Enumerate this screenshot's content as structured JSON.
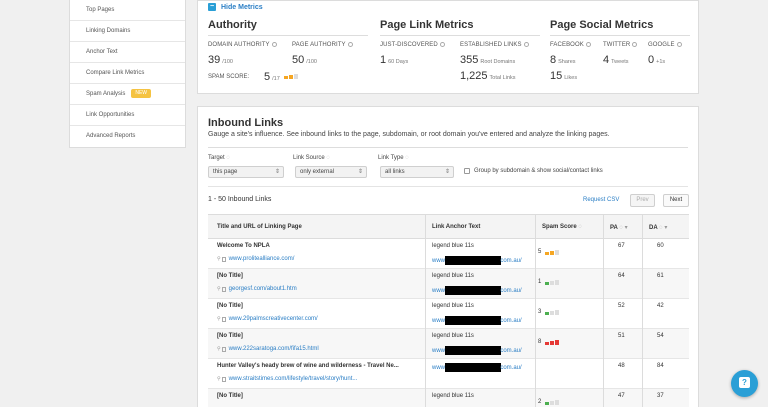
{
  "sidebar": {
    "items": [
      {
        "label": "Top Pages"
      },
      {
        "label": "Linking Domains"
      },
      {
        "label": "Anchor Text"
      },
      {
        "label": "Compare Link Metrics"
      },
      {
        "label": "Spam Analysis",
        "badge": "NEW"
      },
      {
        "label": "Link Opportunities"
      },
      {
        "label": "Advanced Reports"
      }
    ]
  },
  "metrics": {
    "hide_label": "Hide Metrics",
    "authority": {
      "title": "Authority",
      "domain_authority_label": "DOMAIN AUTHORITY",
      "domain_authority": "39",
      "domain_authority_max": "/100",
      "page_authority_label": "PAGE AUTHORITY",
      "page_authority": "50",
      "page_authority_max": "/100",
      "spam_label": "SPAM SCORE:",
      "spam_value": "5",
      "spam_max": "/17",
      "spam_level": 0.29
    },
    "page_link": {
      "title": "Page Link Metrics",
      "just_discovered_label": "JUST-DISCOVERED",
      "just_discovered": "1",
      "just_discovered_unit": "60 Days",
      "established_label": "ESTABLISHED LINKS",
      "root_domains": "355",
      "root_domains_unit": "Root Domains",
      "total_links": "1,225",
      "total_links_unit": "Total Links"
    },
    "social": {
      "title": "Page Social Metrics",
      "facebook_label": "FACEBOOK",
      "twitter_label": "TWITTER",
      "google_label": "GOOGLE",
      "shares": "8",
      "shares_unit": "Shares",
      "tweets": "4",
      "tweets_unit": "Tweets",
      "plus": "0",
      "plus_unit": "+1s",
      "likes": "15",
      "likes_unit": "Likes"
    }
  },
  "inbound": {
    "title": "Inbound Links",
    "description": "Gauge a site's influence. See inbound links to the page, subdomain, or root domain you've entered and analyze the linking pages.",
    "filters": {
      "target_label": "Target",
      "target_value": "this page",
      "source_label": "Link Source",
      "source_value": "only external",
      "type_label": "Link Type",
      "type_value": "all links",
      "group_label": "Group by subdomain & show social/contact links"
    },
    "count_label": "1 - 50 Inbound Links",
    "request_csv": "Request CSV",
    "prev": "Prev",
    "next": "Next",
    "columns": {
      "title": "Title and URL of Linking Page",
      "anchor": "Link Anchor Text",
      "spam": "Spam Score",
      "pa": "PA",
      "da": "DA"
    },
    "rows": [
      {
        "title": "Welcome To NPLA",
        "url": "www.prolitealliance.com/",
        "anchor": "legend blue 11s",
        "target_pre": "www.",
        "target_post": "com.au/",
        "spam": "5",
        "spam_level": "medium",
        "pa": "67",
        "da": "60"
      },
      {
        "title": "[No Title]",
        "url": "georgesf.com/about1.htm",
        "anchor": "legend blue 11s",
        "target_pre": "www.",
        "target_post": "com.au/",
        "spam": "1",
        "spam_level": "low",
        "pa": "64",
        "da": "61"
      },
      {
        "title": "[No Title]",
        "url": "www.29palmscreativecenter.com/",
        "anchor": "legend blue 11s",
        "target_pre": "www.",
        "target_post": "com.au/",
        "spam": "3",
        "spam_level": "low",
        "pa": "52",
        "da": "42"
      },
      {
        "title": "[No Title]",
        "url": "www.222saratoga.com/fifa15.html",
        "anchor": "legend blue 11s",
        "target_pre": "www.",
        "target_post": "com.au/",
        "spam": "8",
        "spam_level": "high",
        "pa": "51",
        "da": "54"
      },
      {
        "title": "Hunter Valley's heady brew of wine and wilderness - Travel Ne...",
        "url": "www.straitstimes.com/lifestyle/travel/story/hunt...",
        "anchor": "",
        "target_pre": "www.",
        "target_post": "com.au/",
        "spam": "",
        "spam_level": "none",
        "pa": "48",
        "da": "84"
      },
      {
        "title": "[No Title]",
        "url": "",
        "anchor": "legend blue 11s",
        "target_pre": "",
        "target_post": "",
        "spam": "2",
        "spam_level": "low",
        "pa": "47",
        "da": "37"
      }
    ]
  },
  "colors": {
    "accent": "#2a9fd6",
    "link": "#2a7ec5",
    "spam_low": "#4caf50",
    "spam_medium": "#f5a623",
    "spam_high": "#e53935"
  }
}
